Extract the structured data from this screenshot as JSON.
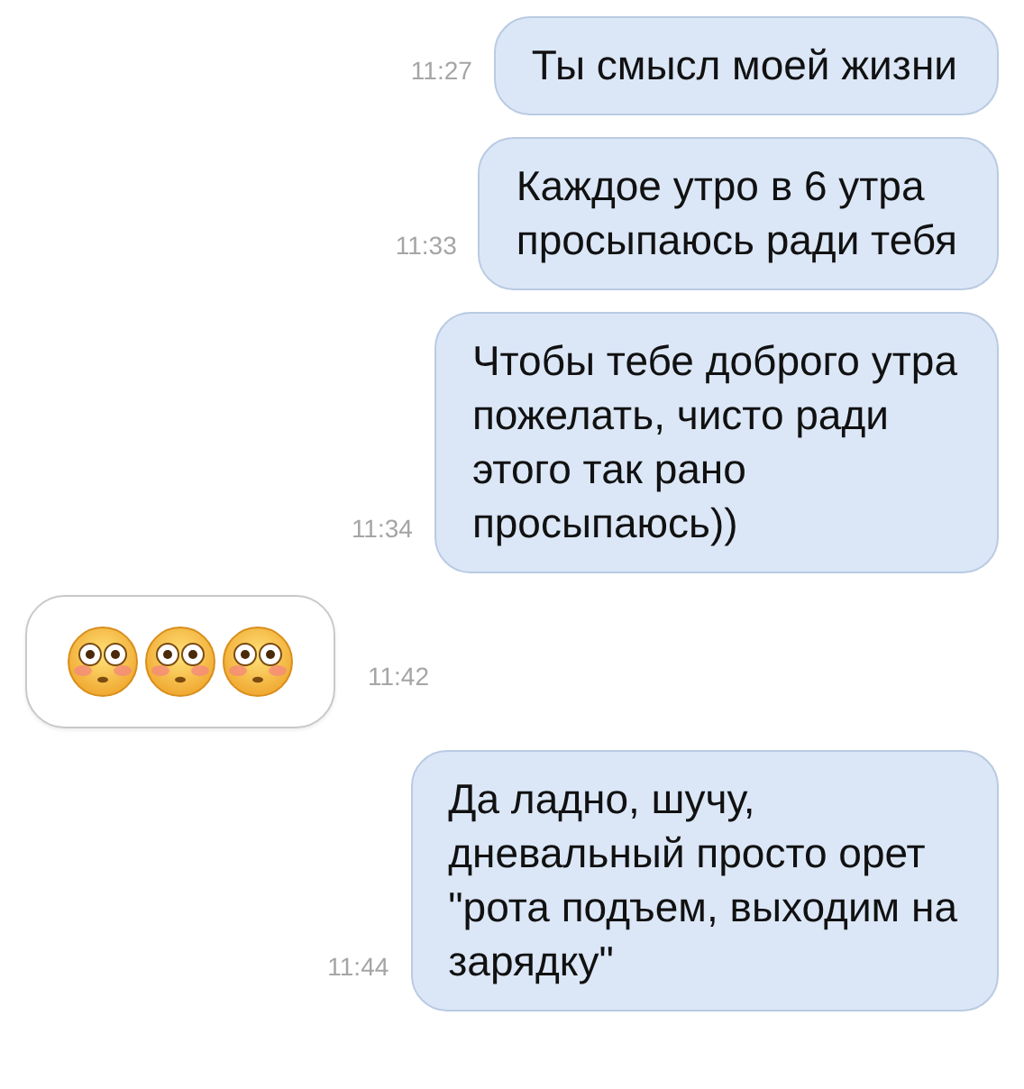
{
  "messages": [
    {
      "kind": "outgoing",
      "time": "11:27",
      "lines": [
        "Ты смысл моей жизни"
      ]
    },
    {
      "kind": "outgoing",
      "time": "11:33",
      "lines": [
        "Каждое утро в 6 утра",
        "просыпаюсь ради тебя"
      ]
    },
    {
      "kind": "outgoing",
      "time": "11:34",
      "lines": [
        "Чтобы тебе доброго утра",
        "пожелать, чисто ради",
        "этого так рано",
        "просыпаюсь))"
      ]
    },
    {
      "kind": "incoming",
      "time": "11:42",
      "emojis": [
        {
          "kind": "flushed"
        },
        {
          "kind": "flushed"
        },
        {
          "kind": "flushed"
        }
      ]
    },
    {
      "kind": "outgoing",
      "time": "11:44",
      "lines": [
        "Да ладно, шучу,",
        "дневальный просто орет",
        "\"рота подъем, выходим на",
        "зарядку\""
      ]
    }
  ]
}
